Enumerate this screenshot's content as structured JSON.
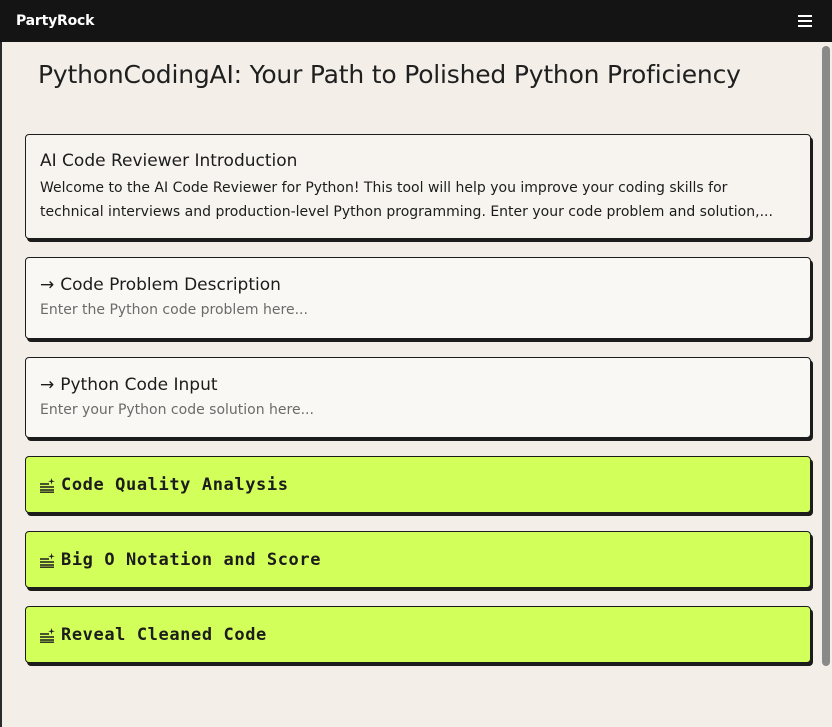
{
  "app": {
    "logo": "PartyRock"
  },
  "page": {
    "title": "PythonCodingAI: Your Path to Polished Python Proficiency"
  },
  "intro": {
    "title": "AI Code Reviewer Introduction",
    "line1": "Welcome to the AI Code Reviewer for Python! This tool will help you improve your coding skills for",
    "line2": "technical interviews and production-level Python programming. Enter your code problem and solution,..."
  },
  "inputs": [
    {
      "arrow": "→",
      "label": "Code Problem Description",
      "placeholder": "Enter the Python code problem here..."
    },
    {
      "arrow": "→",
      "label": "Python Code Input",
      "placeholder": "Enter your Python code solution here..."
    }
  ],
  "actions": [
    {
      "label": "Code Quality Analysis",
      "icon": "sparkle-lines-icon"
    },
    {
      "label": "Big O Notation and Score",
      "icon": "sparkle-lines-icon"
    },
    {
      "label": "Reveal Cleaned Code",
      "icon": "sparkle-lines-icon"
    }
  ],
  "colors": {
    "topbar": "#141414",
    "background": "#f3efe8",
    "action_accent": "#d2ff5a"
  }
}
